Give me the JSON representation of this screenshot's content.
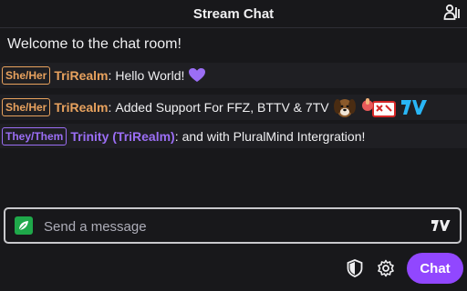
{
  "header": {
    "title": "Stream Chat",
    "users_icon": "users-icon"
  },
  "welcome_text": "Welcome to the chat room!",
  "messages": [
    {
      "pronoun": "She/Her",
      "username": "TriRealm",
      "username_color": "#e8a25e",
      "colon": ":",
      "text": "Hello World!",
      "emotes": [
        "purple-heart-emote"
      ]
    },
    {
      "pronoun": "She/Her",
      "username": "TriRealm",
      "username_color": "#e8a25e",
      "colon": ":",
      "text": "Added Support For FFZ, BTTV & 7TV",
      "emotes": [
        "dog-emote",
        "thumbs-up-emote",
        "seventv-logo-emote"
      ]
    },
    {
      "pronoun": "They/Them",
      "username": "Trinity (TriRealm)",
      "username_color": "#9b6ef5",
      "colon": ":",
      "text": "and with PluralMind Intergration!",
      "emotes": []
    }
  ],
  "input": {
    "placeholder": "Send a message",
    "value": "",
    "leaf_icon": "leaf-icon",
    "seventv_icon": "seventv-icon"
  },
  "toolbar": {
    "shield_icon": "shield-icon",
    "settings_icon": "gear-icon",
    "chat_label": "Chat"
  },
  "colors": {
    "background": "#18181b",
    "accent": "#9147ff",
    "orange_pronoun": "#e8a25e",
    "purple_pronoun": "#9b6ef5",
    "emote_green": "#1fa84a",
    "seventv_blue": "#29b6f6"
  }
}
